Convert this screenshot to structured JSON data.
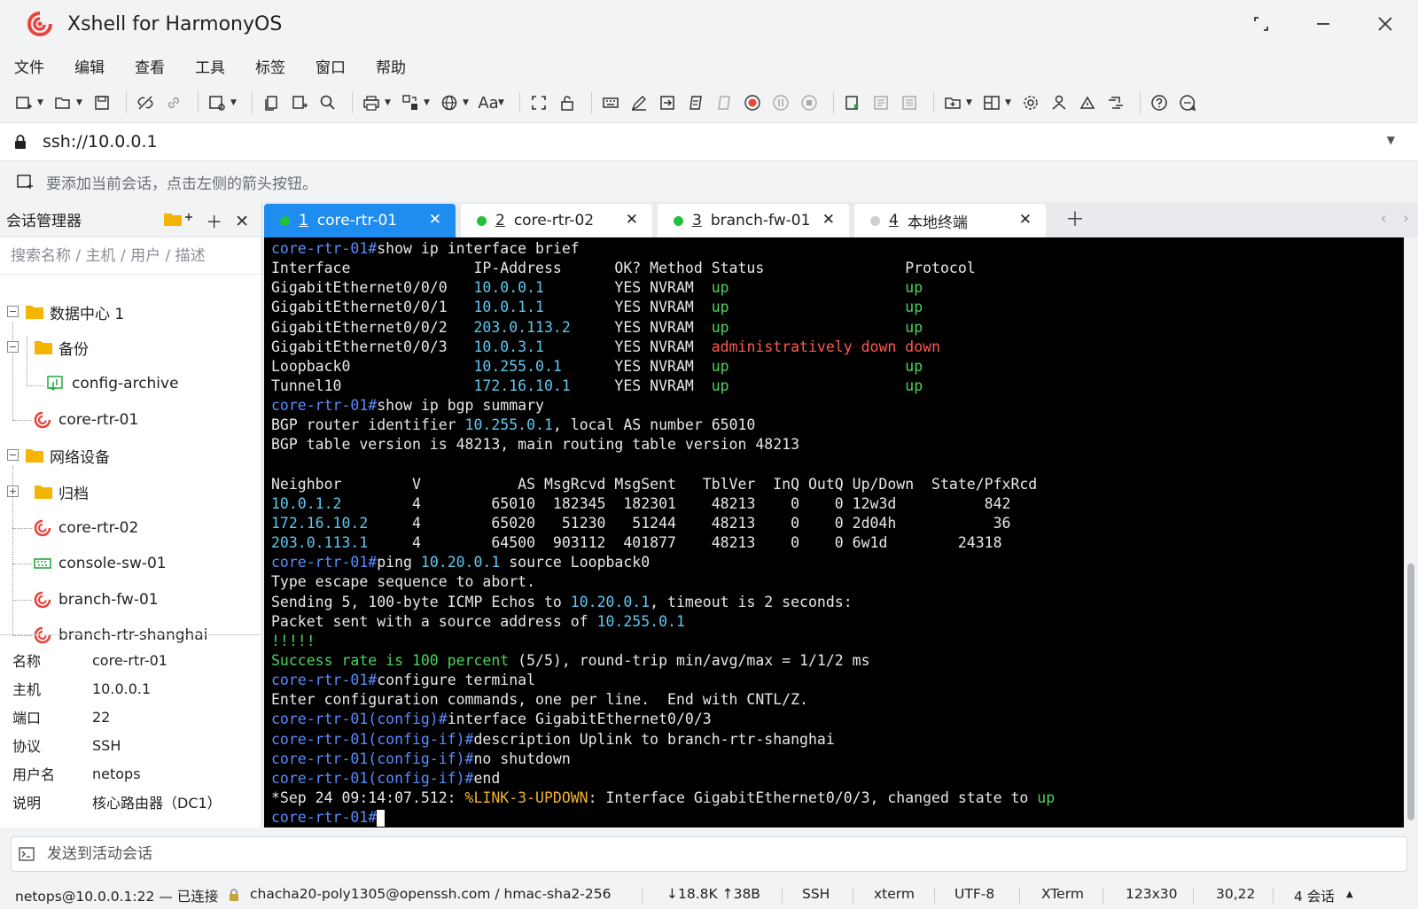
{
  "app": {
    "title": "Xshell for HarmonyOS"
  },
  "menu": [
    "文件",
    "编辑",
    "查看",
    "工具",
    "标签",
    "窗口",
    "帮助"
  ],
  "toolbar": {
    "font_label": "Aa"
  },
  "address": {
    "value": "ssh://10.0.0.1"
  },
  "hint": {
    "text": "要添加当前会话，点击左侧的箭头按钮。"
  },
  "sidebar": {
    "title": "会话管理器",
    "search_placeholder": "搜索名称 / 主机 / 用户 / 描述",
    "tree": [
      {
        "label": "数据中心 1",
        "type": "folder"
      },
      {
        "label": "备份",
        "type": "folder"
      },
      {
        "label": "config-archive",
        "type": "sftp"
      },
      {
        "label": "core-rtr-01",
        "type": "ssh"
      },
      {
        "label": "网络设备",
        "type": "folder"
      },
      {
        "label": "归档",
        "type": "folder"
      },
      {
        "label": "core-rtr-02",
        "type": "ssh"
      },
      {
        "label": "console-sw-01",
        "type": "serial"
      },
      {
        "label": "branch-fw-01",
        "type": "ssh"
      },
      {
        "label": "branch-rtr-shanghai",
        "type": "ssh"
      }
    ],
    "properties": [
      {
        "key": "名称",
        "value": "core-rtr-01"
      },
      {
        "key": "主机",
        "value": "10.0.0.1"
      },
      {
        "key": "端口",
        "value": "22"
      },
      {
        "key": "协议",
        "value": "SSH"
      },
      {
        "key": "用户名",
        "value": "netops"
      },
      {
        "key": "说明",
        "value": "核心路由器（DC1）"
      }
    ]
  },
  "tabs": [
    {
      "num": "1",
      "label": "core-rtr-01",
      "active": true,
      "status_color": "#22c23a"
    },
    {
      "num": "2",
      "label": "core-rtr-02",
      "active": false,
      "status_color": "#22c23a"
    },
    {
      "num": "3",
      "label": "branch-fw-01",
      "active": false,
      "status_color": "#22c23a"
    },
    {
      "num": "4",
      "label": "本地终端",
      "active": false,
      "status_color": "#d0d0d0"
    }
  ],
  "terminal": {
    "lines": [
      [
        [
          "p",
          "core-rtr-01#"
        ],
        [
          "n",
          "show ip interface brief"
        ]
      ],
      [
        [
          "n",
          "Interface              IP-Address      OK? Method Status                Protocol"
        ]
      ],
      [
        [
          "n",
          "GigabitEthernet0/0/0   "
        ],
        [
          "c",
          "10.0.0.1"
        ],
        [
          "n",
          "        YES NVRAM  "
        ],
        [
          "g",
          "up"
        ],
        [
          "n",
          "                    "
        ],
        [
          "g",
          "up"
        ]
      ],
      [
        [
          "n",
          "GigabitEthernet0/0/1   "
        ],
        [
          "c",
          "10.0.1.1"
        ],
        [
          "n",
          "        YES NVRAM  "
        ],
        [
          "g",
          "up"
        ],
        [
          "n",
          "                    "
        ],
        [
          "g",
          "up"
        ]
      ],
      [
        [
          "n",
          "GigabitEthernet0/0/2   "
        ],
        [
          "c",
          "203.0.113.2"
        ],
        [
          "n",
          "     YES NVRAM  "
        ],
        [
          "g",
          "up"
        ],
        [
          "n",
          "                    "
        ],
        [
          "g",
          "up"
        ]
      ],
      [
        [
          "n",
          "GigabitEthernet0/0/3   "
        ],
        [
          "c",
          "10.0.3.1"
        ],
        [
          "n",
          "        YES NVRAM  "
        ],
        [
          "r",
          "administratively down down"
        ]
      ],
      [
        [
          "n",
          "Loopback0              "
        ],
        [
          "c",
          "10.255.0.1"
        ],
        [
          "n",
          "      YES NVRAM  "
        ],
        [
          "g",
          "up"
        ],
        [
          "n",
          "                    "
        ],
        [
          "g",
          "up"
        ]
      ],
      [
        [
          "n",
          "Tunnel10               "
        ],
        [
          "c",
          "172.16.10.1"
        ],
        [
          "n",
          "     YES NVRAM  "
        ],
        [
          "g",
          "up"
        ],
        [
          "n",
          "                    "
        ],
        [
          "g",
          "up"
        ]
      ],
      [
        [
          "p",
          "core-rtr-01#"
        ],
        [
          "n",
          "show ip bgp summary"
        ]
      ],
      [
        [
          "n",
          "BGP router identifier "
        ],
        [
          "c",
          "10.255.0.1"
        ],
        [
          "n",
          ", local AS number 65010"
        ]
      ],
      [
        [
          "n",
          "BGP table version is 48213, main routing table version 48213"
        ]
      ],
      [
        [
          "n",
          ""
        ]
      ],
      [
        [
          "n",
          "Neighbor        V           AS MsgRcvd MsgSent   TblVer  InQ OutQ Up/Down  State/PfxRcd"
        ]
      ],
      [
        [
          "c",
          "10.0.1.2"
        ],
        [
          "n",
          "        4        65010  182345  182301    48213    0    0 12w3d          842"
        ]
      ],
      [
        [
          "c",
          "172.16.10.2"
        ],
        [
          "n",
          "     4        65020   51230   51244    48213    0    0 2d04h           36"
        ]
      ],
      [
        [
          "c",
          "203.0.113.1"
        ],
        [
          "n",
          "     4        64500  903112  401877    48213    0    0 6w1d        24318"
        ]
      ],
      [
        [
          "p",
          "core-rtr-01#"
        ],
        [
          "n",
          "ping "
        ],
        [
          "c",
          "10.20.0.1"
        ],
        [
          "n",
          " source Loopback0"
        ]
      ],
      [
        [
          "n",
          "Type escape sequence to abort."
        ]
      ],
      [
        [
          "n",
          "Sending 5, 100-byte ICMP Echos to "
        ],
        [
          "c",
          "10.20.0.1"
        ],
        [
          "n",
          ", timeout is 2 seconds:"
        ]
      ],
      [
        [
          "n",
          "Packet sent with a source address of "
        ],
        [
          "c",
          "10.255.0.1"
        ]
      ],
      [
        [
          "g",
          "!!!!!"
        ]
      ],
      [
        [
          "g",
          "Success rate is 100 percent"
        ],
        [
          "n",
          " (5/5), round-trip min/avg/max = 1/1/2 ms"
        ]
      ],
      [
        [
          "p",
          "core-rtr-01#"
        ],
        [
          "n",
          "configure terminal"
        ]
      ],
      [
        [
          "n",
          "Enter configuration commands, one per line.  End with CNTL/Z."
        ]
      ],
      [
        [
          "p",
          "core-rtr-01(config)#"
        ],
        [
          "n",
          "interface GigabitEthernet0/0/3"
        ]
      ],
      [
        [
          "p",
          "core-rtr-01(config-if)#"
        ],
        [
          "n",
          "description Uplink to branch-rtr-shanghai"
        ]
      ],
      [
        [
          "p",
          "core-rtr-01(config-if)#"
        ],
        [
          "n",
          "no shutdown"
        ]
      ],
      [
        [
          "p",
          "core-rtr-01(config-if)#"
        ],
        [
          "n",
          "end"
        ]
      ],
      [
        [
          "n",
          "*Sep 24 09:14:07.512: "
        ],
        [
          "y",
          "%LINK-3-UPDOWN"
        ],
        [
          "n",
          ": Interface GigabitEthernet0/0/3, changed state to "
        ],
        [
          "g",
          "up"
        ]
      ],
      [
        [
          "p",
          "core-rtr-01#"
        ],
        [
          "k",
          ""
        ]
      ]
    ],
    "colors": {
      "prompt": "#5b8cff",
      "ip": "#5fc8f0",
      "ok": "#4cd35a",
      "error": "#ff5a52",
      "log": "#f0b22a"
    }
  },
  "sendbar": {
    "placeholder": "发送到活动会话"
  },
  "status": {
    "connection": "netops@10.0.0.1:22 — 已连接",
    "cipher": "chacha20-poly1305@openssh.com / hmac-sha2-256",
    "traffic": "↓18.8K ↑38B",
    "protocol": "SSH",
    "term_type": "xterm",
    "encoding": "UTF-8",
    "emulation": "XTerm",
    "size": "123x30",
    "cursor_pos": "30,22",
    "sessions": "4 会话"
  }
}
